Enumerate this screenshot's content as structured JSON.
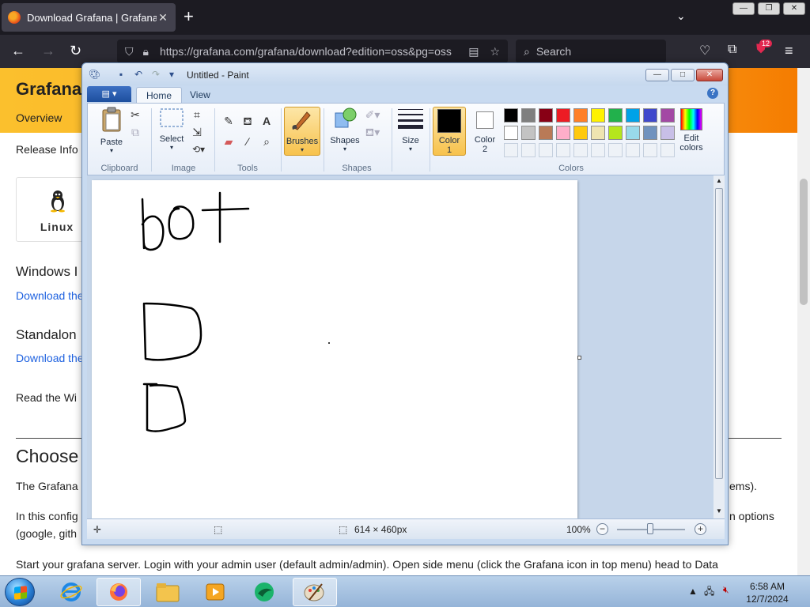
{
  "browser": {
    "tab_title": "Download Grafana | Grafana La",
    "new_tab": "+",
    "url": "https://grafana.com/grafana/download?edition=oss&pg=oss",
    "search_placeholder": "Search",
    "badge_count": "12"
  },
  "page": {
    "header_title": "Grafana",
    "nav_overview": "Overview",
    "release_info": "Release Info",
    "linux_label": "Linux",
    "windows_heading": "Windows I",
    "windows_link": "Download the",
    "standalone_heading": "Standalon",
    "standalone_link": "Download the",
    "read_text": "Read the Wi",
    "choose_heading": "Choose",
    "para1_left": "The Grafana",
    "para1_right": "ems).",
    "para2_left": "In this config",
    "para2_right": "n options",
    "para2_line2": "(google, gith",
    "para3": "Start your grafana server. Login with your admin user (default admin/admin). Open side menu (click the Grafana icon in top menu) head to Data"
  },
  "paint": {
    "title": "Untitled - Paint",
    "tabs": {
      "home": "Home",
      "view": "View"
    },
    "help": "?",
    "groups": {
      "clipboard": "Clipboard",
      "image": "Image",
      "tools": "Tools",
      "shapes": "Shapes",
      "colors": "Colors"
    },
    "buttons": {
      "paste": "Paste",
      "select": "Select",
      "brushes": "Brushes",
      "shapes": "Shapes",
      "size": "Size",
      "color1": "Color",
      "color1_num": "1",
      "color2": "Color",
      "color2_num": "2",
      "edit_colors_1": "Edit",
      "edit_colors_2": "colors"
    },
    "palette_row1": [
      "#000000",
      "#7f7f7f",
      "#880015",
      "#ed1c24",
      "#ff7f27",
      "#fff200",
      "#22b14c",
      "#00a2e8",
      "#3f48cc",
      "#a349a4"
    ],
    "palette_row2": [
      "#ffffff",
      "#c3c3c3",
      "#b97a57",
      "#ffaec9",
      "#ffc90e",
      "#efe4b0",
      "#b5e61d",
      "#99d9ea",
      "#7092be",
      "#c8bfe7"
    ],
    "color1_value": "#000000",
    "color2_value": "#ffffff",
    "status": {
      "canvas_size": "614 × 460px",
      "zoom": "100%"
    }
  },
  "taskbar": {
    "time": "6:58 AM",
    "date": "12/7/2024"
  }
}
